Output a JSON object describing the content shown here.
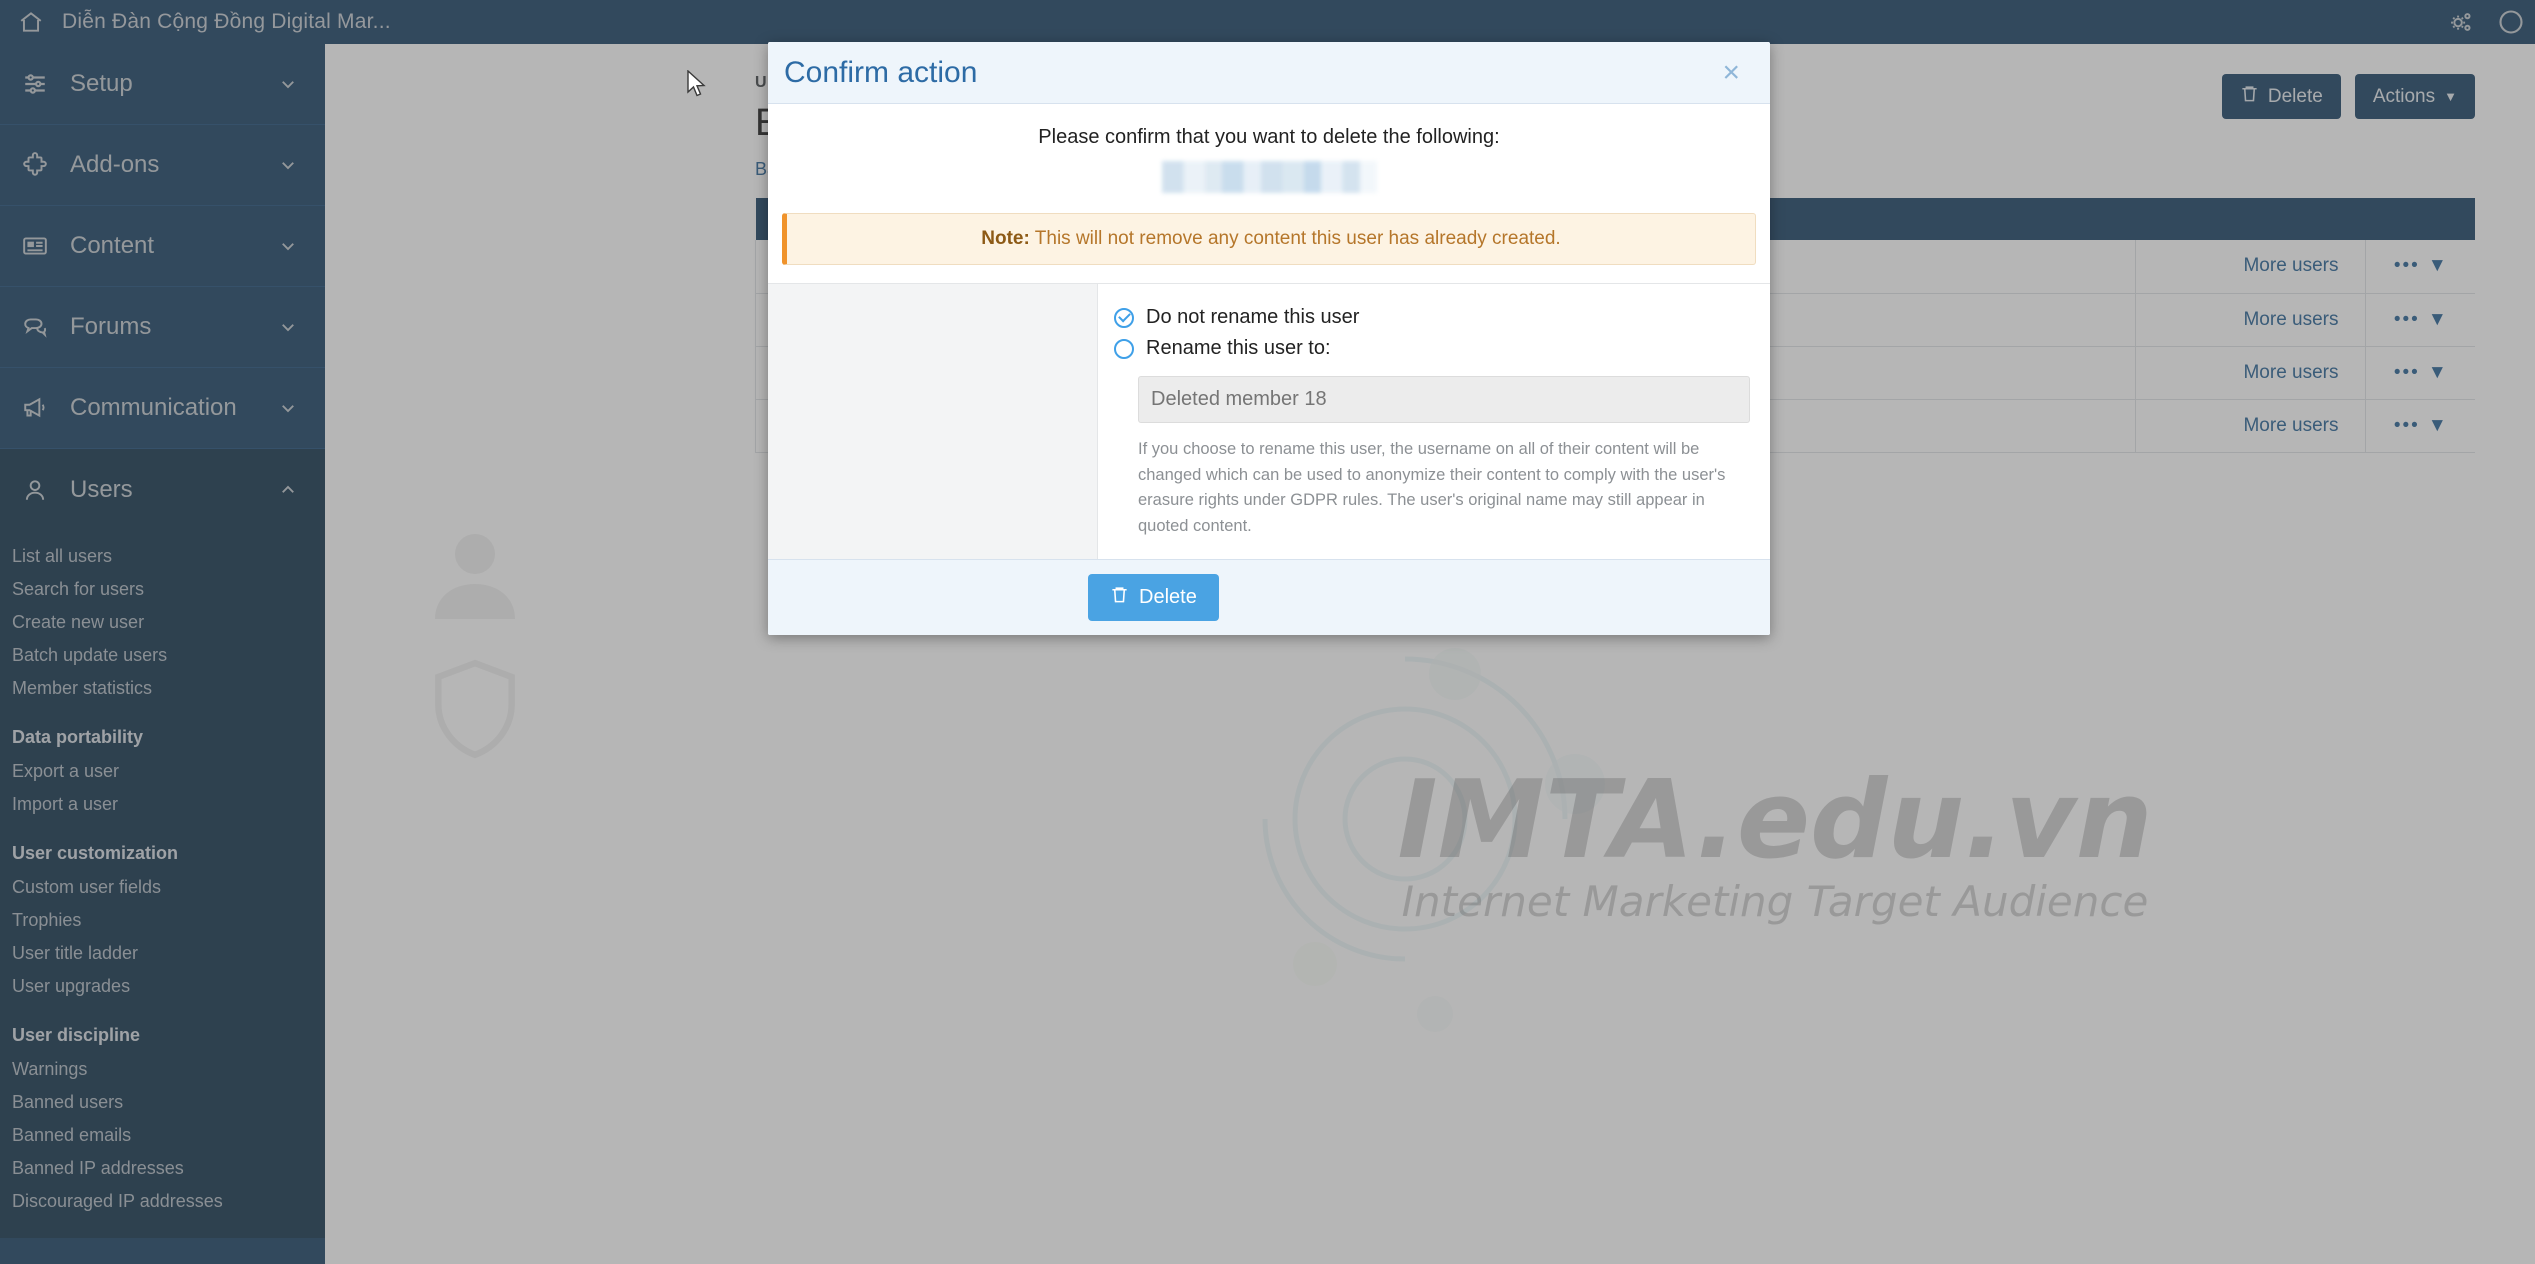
{
  "topbar": {
    "home_icon": "home-icon",
    "title": "Diễn Đàn Cộng Đồng Digital Mar...",
    "settings_icon": "gears-icon",
    "account_icon": "user-circle-icon"
  },
  "sidebar": {
    "groups": [
      {
        "label": "Setup",
        "icon": "sliders-icon",
        "state": "collapsed"
      },
      {
        "label": "Add-ons",
        "icon": "puzzle-icon",
        "state": "collapsed"
      },
      {
        "label": "Content",
        "icon": "newspaper-icon",
        "state": "collapsed"
      },
      {
        "label": "Forums",
        "icon": "comments-icon",
        "state": "collapsed"
      },
      {
        "label": "Communication",
        "icon": "bullhorn-icon",
        "state": "collapsed"
      },
      {
        "label": "Users",
        "icon": "user-icon",
        "state": "expanded"
      }
    ],
    "users_items": [
      {
        "label": "List all users",
        "type": "link"
      },
      {
        "label": "Search for users",
        "type": "link"
      },
      {
        "label": "Create new user",
        "type": "link"
      },
      {
        "label": "Batch update users",
        "type": "link"
      },
      {
        "label": "Member statistics",
        "type": "link"
      },
      {
        "label": "Data portability",
        "type": "heading"
      },
      {
        "label": "Export a user",
        "type": "link"
      },
      {
        "label": "Import a user",
        "type": "link"
      },
      {
        "label": "User customization",
        "type": "heading"
      },
      {
        "label": "Custom user fields",
        "type": "link"
      },
      {
        "label": "Trophies",
        "type": "link"
      },
      {
        "label": "User title ladder",
        "type": "link"
      },
      {
        "label": "User upgrades",
        "type": "link"
      },
      {
        "label": "User discipline",
        "type": "heading"
      },
      {
        "label": "Warnings",
        "type": "link"
      },
      {
        "label": "Banned users",
        "type": "link"
      },
      {
        "label": "Banned emails",
        "type": "link"
      },
      {
        "label": "Banned IP addresses",
        "type": "link"
      },
      {
        "label": "Discouraged IP addresses",
        "type": "link"
      }
    ]
  },
  "page": {
    "breadcrumb": "U",
    "heading": "E",
    "subheading": "Ba",
    "toolbar": {
      "delete_label": "Delete",
      "actions_label": "Actions"
    },
    "rows": [
      {
        "more_users": "More users",
        "menu": "•••"
      },
      {
        "more_users": "More users",
        "menu": "•••"
      },
      {
        "more_users": "More users",
        "menu": "•••"
      },
      {
        "more_users": "More users",
        "menu": "•••"
      }
    ],
    "watermark": {
      "line1": "IMTA.edu.vn",
      "line2": "Internet Marketing Target Audience"
    }
  },
  "modal": {
    "title": "Confirm action",
    "close_icon": "close-icon",
    "confirm_text": "Please confirm that you want to delete the following:",
    "redacted_name": "",
    "note_label": "Note:",
    "note_text": "This will not remove any content this user has already created.",
    "options": [
      {
        "label": "Do not rename this user",
        "selected": true
      },
      {
        "label": "Rename this user to:",
        "selected": false
      }
    ],
    "rename_placeholder": "Deleted member 18",
    "rename_value": "",
    "helper_text": "If you choose to rename this user, the username on all of their content will be changed which can be used to anonymize their content to comply with the user's erasure rights under GDPR rules. The user's original name may still appear in quoted content.",
    "delete_label": "Delete",
    "delete_icon": "trash-icon"
  },
  "colors": {
    "sidebar_bg": "#1c4466",
    "sidebar_active": "#15364f",
    "modal_header_bg": "#eef5fb",
    "modal_title": "#2d6ba5",
    "accent_blue": "#4aa3e3",
    "note_orange": "#f0932b",
    "note_bg": "#fdf3e3"
  }
}
